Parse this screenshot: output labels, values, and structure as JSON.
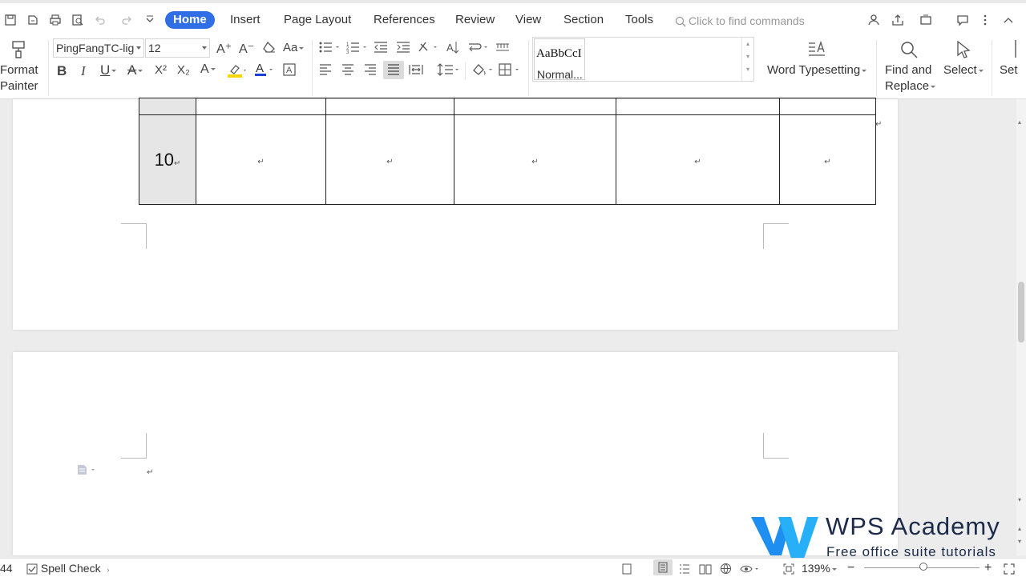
{
  "menu": {
    "tabs": [
      "Home",
      "Insert",
      "Page Layout",
      "References",
      "Review",
      "View",
      "Section",
      "Tools"
    ],
    "active_tab": "Home",
    "search_placeholder": "Click to find commands"
  },
  "ribbon": {
    "format_painter": [
      "Format",
      "Painter"
    ],
    "font_name": "PingFangTC-lig",
    "font_size": "12",
    "style_preview": "AaBbCcI",
    "style_name": "Normal...",
    "word_typesetting": "Word Typesetting",
    "find_replace": [
      "Find and",
      "Replace"
    ],
    "select": "Select",
    "settings_partial": "Set"
  },
  "document": {
    "table_row_number": "10",
    "paragraph_mark": "↵"
  },
  "status": {
    "page_count_partial": "44",
    "spell_check": "Spell Check",
    "zoom": "139%"
  },
  "watermark": {
    "title": "WPS Academy",
    "subtitle": "Free office suite tutorials"
  },
  "colors": {
    "accent": "#2f6ee5",
    "highlight": "#f5d800",
    "font_color": "#1a3fd6",
    "logo_blue": "#1e8ef0"
  }
}
